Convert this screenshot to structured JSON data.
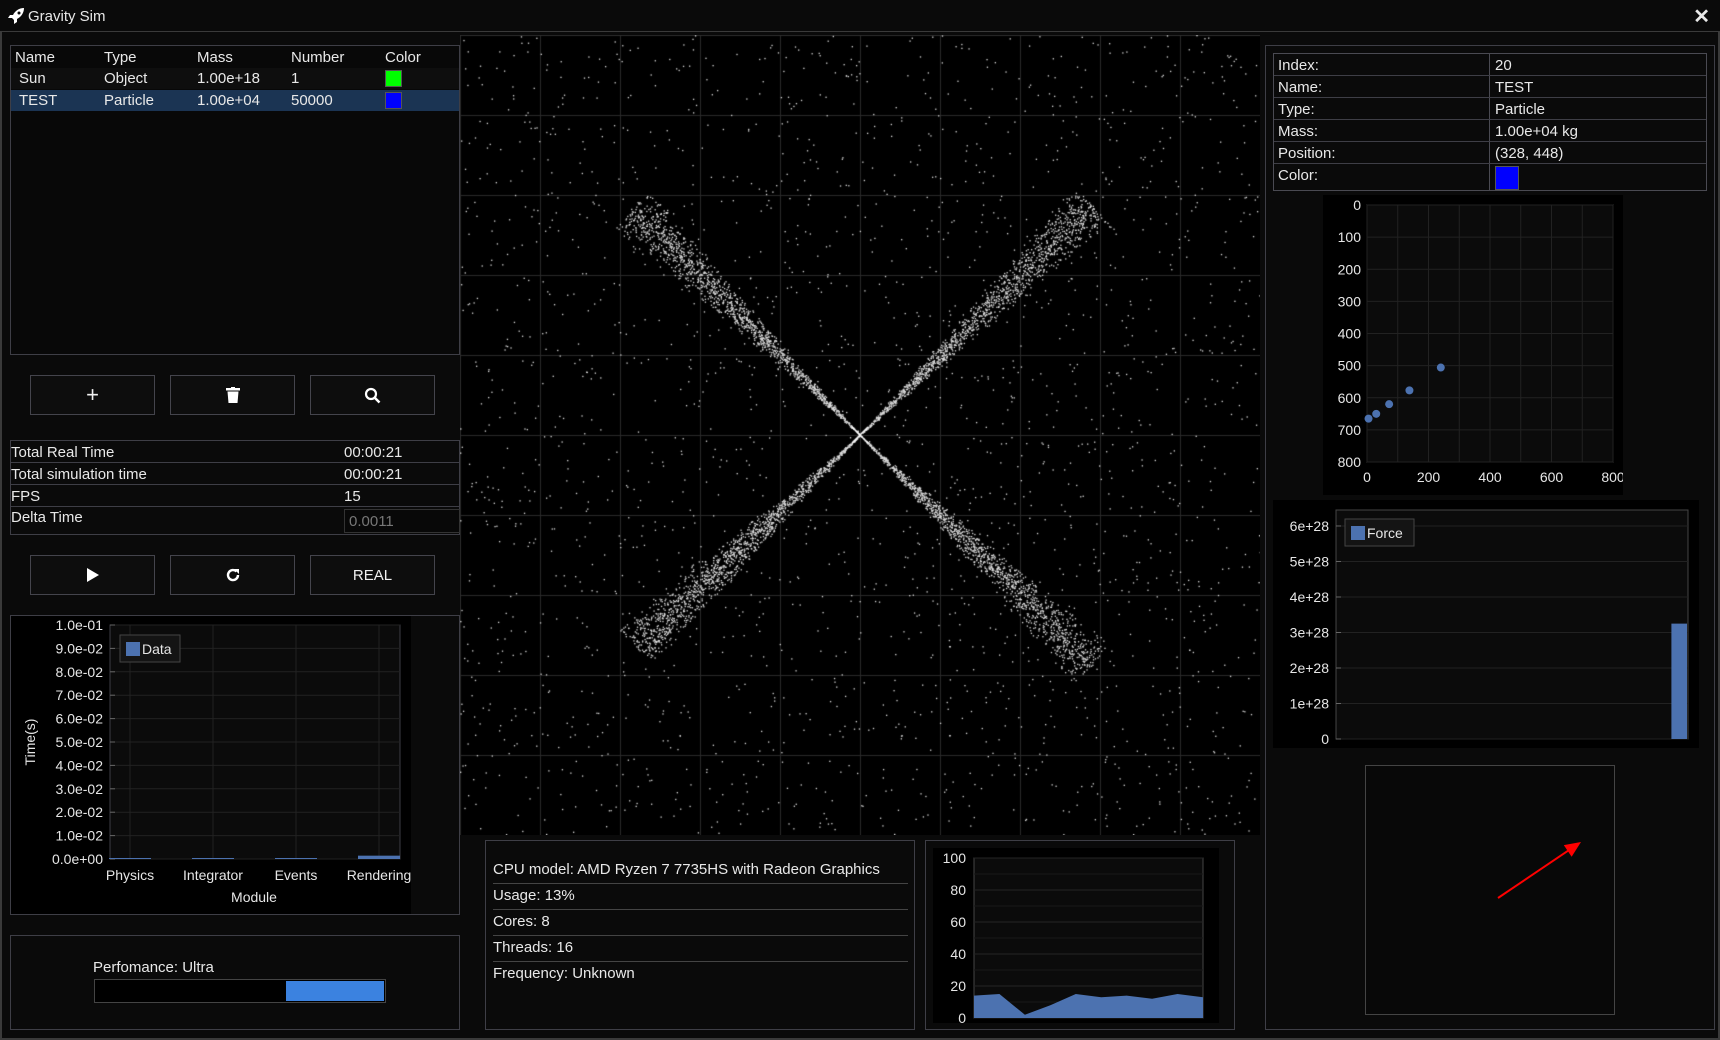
{
  "window": {
    "title": "Gravity Sim",
    "close_icon": "close-icon",
    "app_icon": "rocket-icon"
  },
  "objects_table": {
    "columns": [
      "Name",
      "Type",
      "Mass",
      "Number",
      "Color"
    ],
    "rows": [
      {
        "name": "Sun",
        "type": "Object",
        "mass": "1.00e+18",
        "number": "1",
        "color": "#00ff00",
        "selected": false
      },
      {
        "name": "TEST",
        "type": "Particle",
        "mass": "1.00e+04",
        "number": "50000",
        "color": "#0000ff",
        "selected": true
      }
    ]
  },
  "toolbar": {
    "add_icon": "plus-icon",
    "delete_icon": "trash-icon",
    "search_icon": "search-icon"
  },
  "stats": {
    "rows": [
      {
        "label": "Total Real Time",
        "value": "00:00:21"
      },
      {
        "label": "Total simulation time",
        "value": "00:00:21"
      },
      {
        "label": "FPS",
        "value": "15"
      }
    ],
    "delta_label": "Delta Time",
    "delta_value": "0.0011"
  },
  "controls": {
    "play_icon": "play-icon",
    "reset_icon": "refresh-icon",
    "mode_label": "REAL"
  },
  "performance": {
    "label": "Perfomance: Ultra",
    "bar_fill_start": 0.66,
    "bar_fill_end": 1.0,
    "bar_color": "#3b82e0"
  },
  "cpu": {
    "lines": [
      "CPU model: AMD Ryzen 7 7735HS with Radeon Graphics",
      "Usage: 13%",
      "Cores: 8",
      "Threads: 16",
      "Frequency: Unknown"
    ]
  },
  "selected_info": {
    "rows": [
      {
        "label": "Index:",
        "value": "20"
      },
      {
        "label": "Name:",
        "value": "TEST"
      },
      {
        "label": "Type:",
        "value": "Particle"
      },
      {
        "label": "Mass:",
        "value": "1.00e+04 kg"
      },
      {
        "label": "Position:",
        "value": "(328, 448)"
      }
    ],
    "color_label": "Color:",
    "color": "#0000ff"
  },
  "accent": {
    "series": "#4c72b0",
    "arrow": "#ff0000"
  },
  "chart_data": [
    {
      "id": "module-time",
      "type": "bar",
      "title": "",
      "xlabel": "Module",
      "ylabel": "Time(s)",
      "categories": [
        "Physics",
        "Integrator",
        "Events",
        "Rendering"
      ],
      "series": [
        {
          "name": "Data",
          "values": [
            0.0,
            0.0,
            0.0,
            0.001
          ]
        }
      ],
      "ylim": [
        0,
        0.1
      ],
      "yticks": [
        "0.0e+00",
        "1.0e-02",
        "2.0e-02",
        "3.0e-02",
        "4.0e-02",
        "5.0e-02",
        "6.0e-02",
        "7.0e-02",
        "8.0e-02",
        "9.0e-02",
        "1.0e-01"
      ],
      "grid": true,
      "legend": "top-left"
    },
    {
      "id": "position-trail",
      "type": "scatter",
      "xlim": [
        0,
        800
      ],
      "ylim": [
        0,
        800
      ],
      "y_inverted": true,
      "xticks": [
        "0",
        "200",
        "400",
        "600",
        "800"
      ],
      "yticks": [
        "0",
        "100",
        "200",
        "300",
        "400",
        "500",
        "600",
        "700",
        "800"
      ],
      "points": [
        [
          5,
          665
        ],
        [
          30,
          650
        ],
        [
          72,
          620
        ],
        [
          138,
          577
        ],
        [
          240,
          506
        ]
      ],
      "grid": true
    },
    {
      "id": "force",
      "type": "bar",
      "series": [
        {
          "name": "Force",
          "values": [
            0,
            0,
            0,
            0,
            0,
            0,
            0,
            0,
            0,
            0,
            0,
            0,
            0,
            0,
            0,
            0,
            0,
            0,
            0,
            3.25e+28
          ]
        }
      ],
      "ylim": [
        0,
        6.45e+28
      ],
      "yticks": [
        "0",
        "1e+28",
        "2e+28",
        "3e+28",
        "4e+28",
        "5e+28",
        "6e+28"
      ],
      "grid": true,
      "legend": "top-left"
    },
    {
      "id": "cpu-usage",
      "type": "area",
      "ylim": [
        0,
        100
      ],
      "yticks": [
        "0",
        "20",
        "40",
        "60",
        "80",
        "100"
      ],
      "values": [
        14,
        15,
        2,
        8,
        15,
        13,
        14,
        12,
        15,
        13
      ],
      "grid": true
    },
    {
      "id": "force-vector",
      "type": "vector",
      "direction": [
        0.83,
        -0.56
      ]
    }
  ]
}
